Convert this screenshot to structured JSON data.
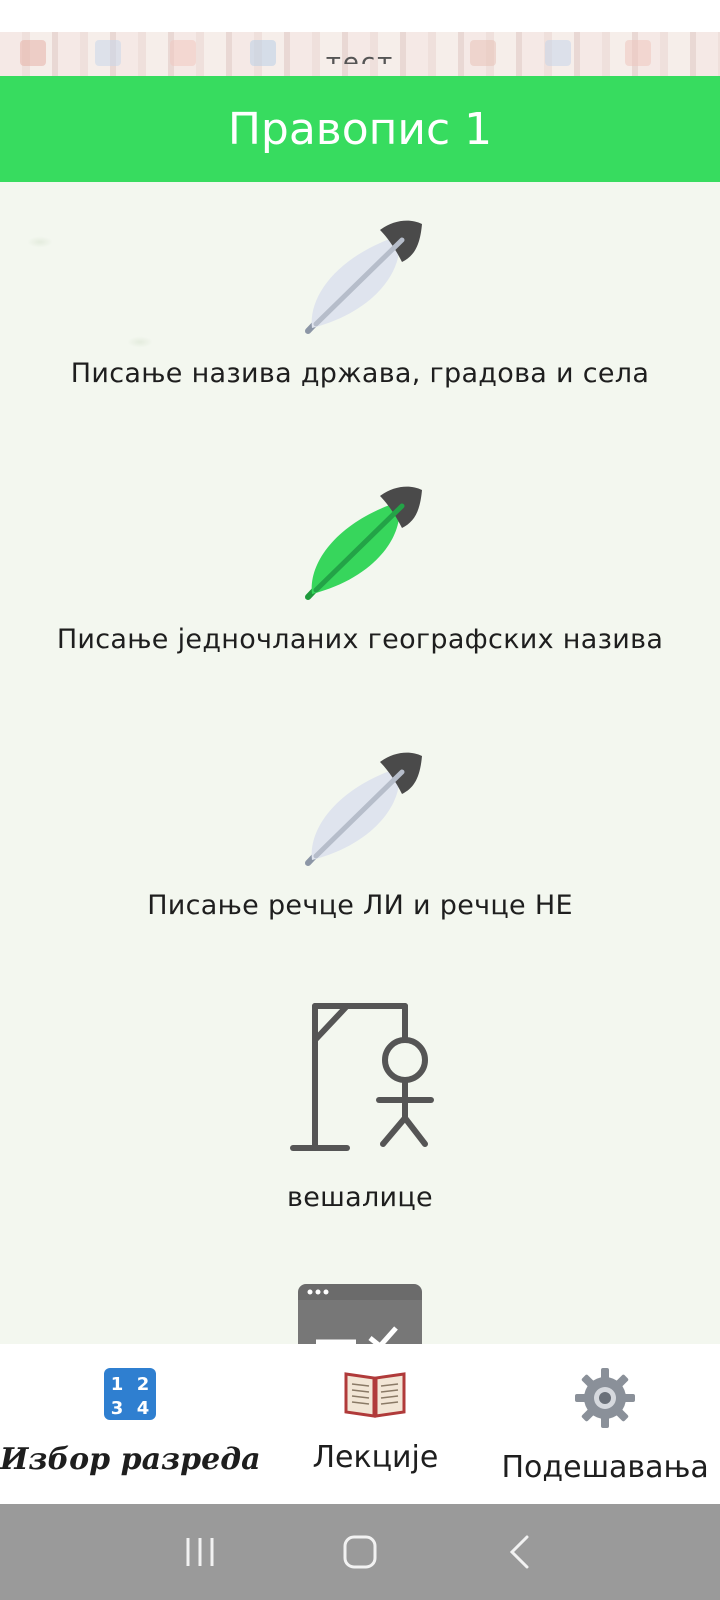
{
  "top_banner": {
    "label": "тест"
  },
  "header": {
    "title": "Правопис 1"
  },
  "lessons": [
    {
      "label": "Писање назива држава, градова и села",
      "icon": "feather-gray-icon"
    },
    {
      "label": "Писање једночланих географских назива",
      "icon": "feather-green-icon"
    },
    {
      "label": "Писање речце ЛИ и речце НЕ",
      "icon": "feather-gray-icon"
    },
    {
      "label": "вешалице",
      "icon": "hangman-icon"
    }
  ],
  "bottom_nav": {
    "items": [
      {
        "label": "Избор разреда",
        "icon": "numbers-grid-icon",
        "active": true
      },
      {
        "label": "Лекције",
        "icon": "book-icon",
        "active": false
      },
      {
        "label": "Подешавања",
        "icon": "gear-icon",
        "active": false
      }
    ]
  },
  "system_nav": {
    "recent": "recent-apps-icon",
    "home": "home-icon",
    "back": "back-icon"
  },
  "colors": {
    "accent": "#37dc5f",
    "nav_bg": "#9a9a9a",
    "feather_gray": "#dfe4ee",
    "feather_dark": "#4a4a4a"
  }
}
